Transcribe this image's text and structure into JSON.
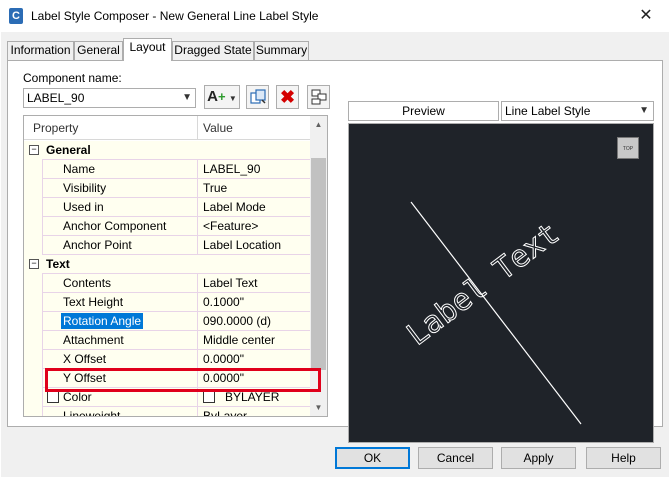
{
  "window": {
    "app_icon_letter": "C",
    "title": "Label Style Composer - New General Line Label Style",
    "close_glyph": "✕"
  },
  "tabs": [
    {
      "label": "Information",
      "active": false
    },
    {
      "label": "General",
      "active": false
    },
    {
      "label": "Layout",
      "active": true
    },
    {
      "label": "Dragged State",
      "active": false
    },
    {
      "label": "Summary",
      "active": false
    }
  ],
  "component": {
    "label": "Component name:",
    "value": "LABEL_90"
  },
  "toolbar": {
    "add_icon": "add-component-icon",
    "copy_icon": "copy-component-icon",
    "delete_icon": "delete-component-icon",
    "order_icon": "component-draw-order-icon"
  },
  "grid": {
    "col_property": "Property",
    "col_value": "Value",
    "rows": [
      {
        "type": "category",
        "property": "General",
        "value": ""
      },
      {
        "type": "item",
        "property": "Name",
        "value": "LABEL_90"
      },
      {
        "type": "item",
        "property": "Visibility",
        "value": "True"
      },
      {
        "type": "item",
        "property": "Used in",
        "value": "Label Mode"
      },
      {
        "type": "item",
        "property": "Anchor Component",
        "value": "<Feature>"
      },
      {
        "type": "item",
        "property": "Anchor Point",
        "value": "Label Location"
      },
      {
        "type": "category",
        "property": "Text",
        "value": ""
      },
      {
        "type": "item",
        "property": "Contents",
        "value": "Label Text"
      },
      {
        "type": "item",
        "property": "Text Height",
        "value": "0.1000\""
      },
      {
        "type": "item",
        "property": "Rotation Angle",
        "value": "090.0000 (d)",
        "selected": true
      },
      {
        "type": "item",
        "property": "Attachment",
        "value": "Middle center"
      },
      {
        "type": "item",
        "property": "X Offset",
        "value": "0.0000\""
      },
      {
        "type": "item",
        "property": "Y Offset",
        "value": "0.0000\""
      },
      {
        "type": "check",
        "property": "Color",
        "value": "BYLAYER"
      },
      {
        "type": "item",
        "property": "Lineweight",
        "value": "ByLayer"
      }
    ]
  },
  "preview": {
    "header": "Preview",
    "style_select": "Line Label Style",
    "label_text": "Label Text",
    "view_cube_label": "TOP",
    "colors": {
      "background": "#1f2329",
      "stroke": "#ffffff"
    }
  },
  "buttons": {
    "ok": "OK",
    "cancel": "Cancel",
    "apply": "Apply",
    "help": "Help"
  }
}
